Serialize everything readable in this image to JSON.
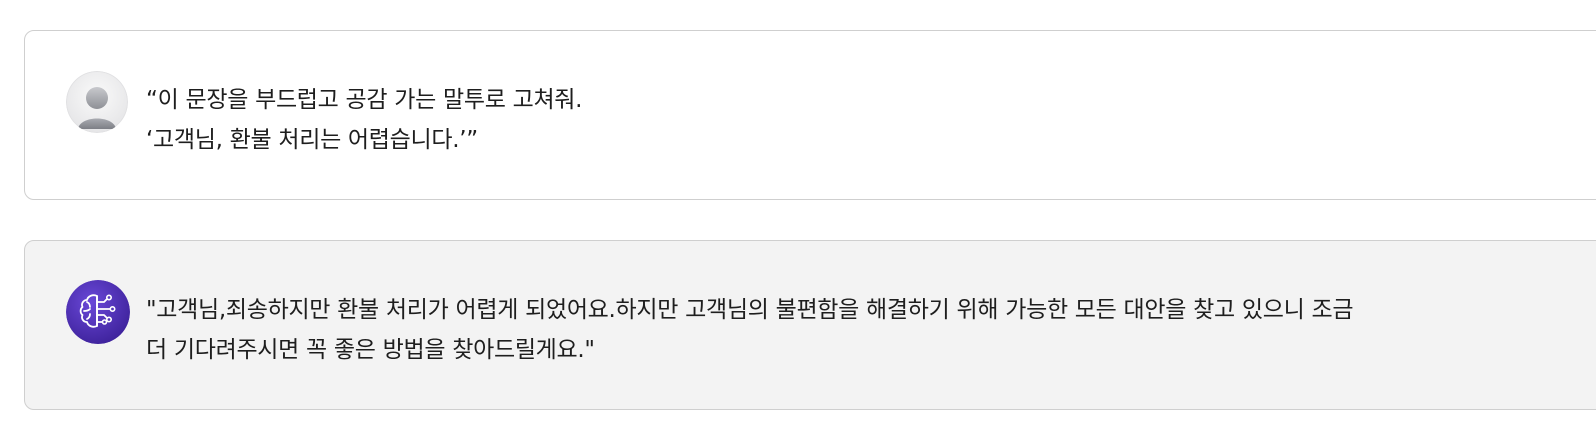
{
  "conversation": {
    "user_message": {
      "avatar_icon": "user-avatar-icon",
      "lines": [
        "“이 문장을 부드럽고 공감 가는 말투로 고쳐줘.",
        "‘고객님, 환불 처리는 어렵습니다.’”"
      ]
    },
    "ai_message": {
      "avatar_icon": "ai-brain-circuit-icon",
      "accent_color": "#4a2fb0",
      "lines": [
        "\"고객님,죄송하지만 환불 처리가 어렵게 되었어요.하지만 고객님의 불편함을 해결하기 위해 가능한 모든 대안을 찾고 있으니 조금",
        "더 기다려주시면 꼭 좋은 방법을 찾아드릴게요.\""
      ]
    }
  }
}
